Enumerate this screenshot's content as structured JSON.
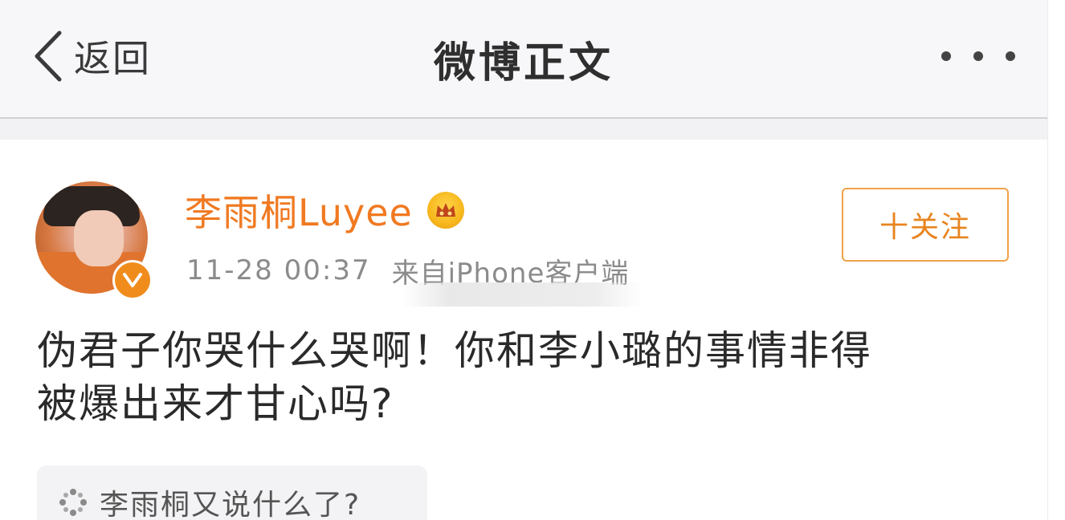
{
  "nav": {
    "back_label": "返回",
    "title": "微博正文",
    "more_icon": "more-dots-icon"
  },
  "post": {
    "author": "李雨桐Luyee",
    "time": "11-28 00:37",
    "source": "来自iPhone客户端",
    "follow_label": "十关注",
    "text_lines": [
      "伪君子你哭什么哭啊！你和李小璐的事情非得",
      "被爆出来才甘心吗?"
    ],
    "topic": "李雨桐又说什么了?"
  },
  "colors": {
    "accent": "#f07a22",
    "nav_bg": "#f7f7f9",
    "verify_badge": "#f08c1c"
  }
}
